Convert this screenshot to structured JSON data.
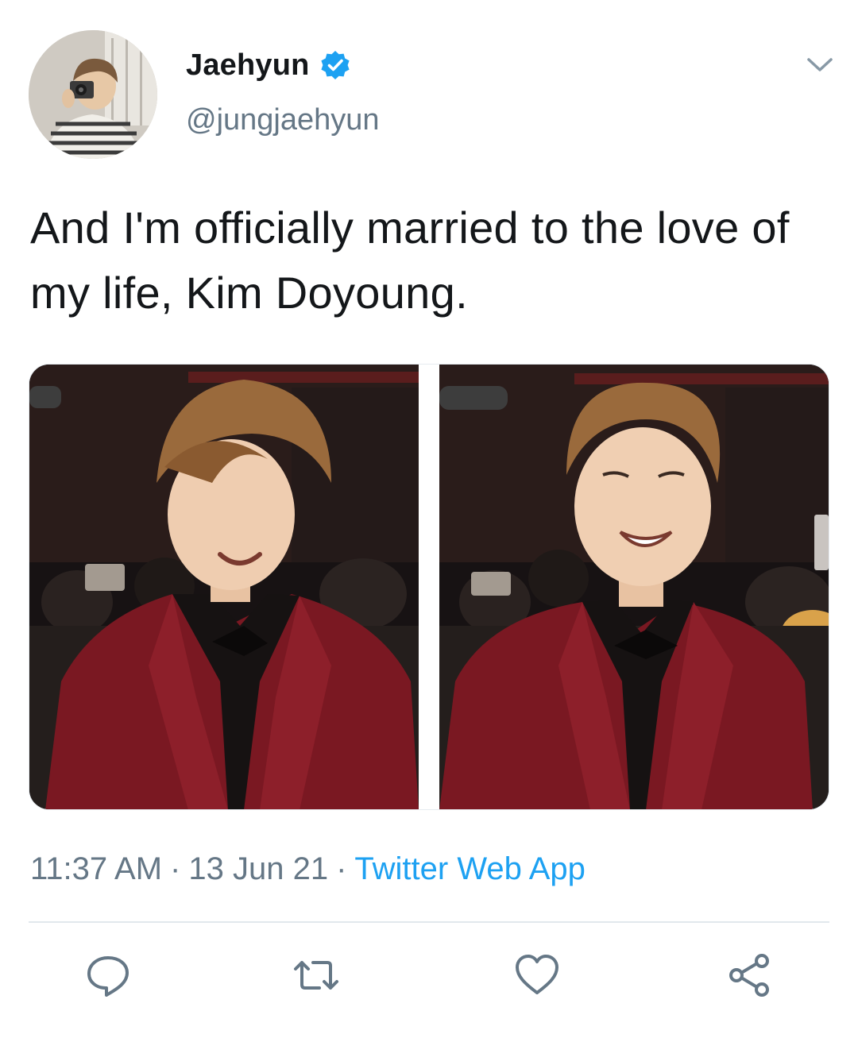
{
  "author": {
    "display_name": "Jaehyun",
    "handle": "@jungjaehyun",
    "verified": true,
    "avatar_icon": "profile-photo"
  },
  "tweet": {
    "text": "And I'm officially married to the love of my life, Kim Doyoung."
  },
  "media": {
    "count": 2
  },
  "meta": {
    "time": "11:37 AM",
    "separator": "·",
    "date": "13 Jun 21",
    "source": "Twitter Web App"
  },
  "actions": {
    "reply_icon": "reply-icon",
    "retweet_icon": "retweet-icon",
    "like_icon": "heart-icon",
    "share_icon": "share-icon"
  },
  "colors": {
    "text": "#14171a",
    "secondary": "#657786",
    "accent": "#1da1f2",
    "divider": "#e1e8ed"
  }
}
